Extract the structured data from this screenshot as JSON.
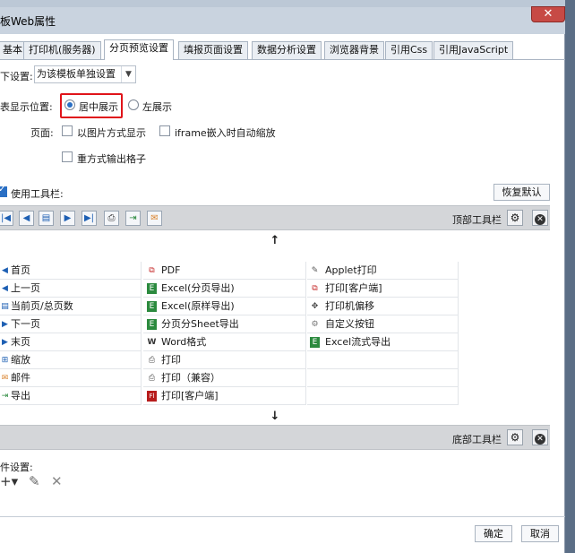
{
  "window": {
    "title": "板Web属性",
    "close_glyph": "✕"
  },
  "tabs": [
    "基本",
    "打印机(服务器)",
    "分页预览设置",
    "填报页面设置",
    "数据分析设置",
    "浏览器背景",
    "引用Css",
    "引用JavaScript"
  ],
  "form": {
    "setting_label": "下设置:",
    "setting_value": "为该模板单独设置",
    "position_label": "表显示位置:",
    "position_options": [
      {
        "label": "居中展示",
        "selected": true
      },
      {
        "label": "左展示",
        "selected": false
      }
    ],
    "page_label": "页面:",
    "page_options": [
      {
        "label": "以图片方式显示",
        "checked": false
      },
      {
        "label": "iframe嵌入时自动缩放",
        "checked": false
      },
      {
        "label": "重方式输出格子",
        "checked": false
      }
    ],
    "use_toolbar_label": "使用工具栏:",
    "use_toolbar_checked": true,
    "restore_default_label": "恢复默认"
  },
  "top_toolbar": {
    "label": "顶部工具栏",
    "icons": [
      "first-page-icon",
      "prev-page-icon",
      "page-number-icon",
      "next-page-icon",
      "last-page-icon",
      "print-icon",
      "export-icon",
      "email-icon"
    ],
    "icon_glyphs": [
      "|◀",
      "◀",
      "▤",
      "▶",
      "▶|",
      "⎙",
      "⇥",
      "✉"
    ]
  },
  "up_arrow": "↑",
  "down_arrow": "↓",
  "button_grid": {
    "col1": [
      {
        "label": "首页",
        "icon": "first-page-icon",
        "glyph": "◀"
      },
      {
        "label": "上一页",
        "icon": "prev-page-icon",
        "glyph": "◀"
      },
      {
        "label": "当前页/总页数",
        "icon": "page-number-icon",
        "glyph": "▤"
      },
      {
        "label": "下一页",
        "icon": "next-page-icon",
        "glyph": "▶"
      },
      {
        "label": "末页",
        "icon": "last-page-icon",
        "glyph": "▶"
      },
      {
        "label": "缩放",
        "icon": "zoom-icon",
        "glyph": "⊞"
      },
      {
        "label": "邮件",
        "icon": "email-icon",
        "glyph": "✉"
      },
      {
        "label": "导出",
        "icon": "export-icon",
        "glyph": "⇥"
      }
    ],
    "col2": [
      {
        "label": "PDF",
        "icon": "pdf-icon",
        "glyph": "⧉"
      },
      {
        "label": "Excel(分页导出)",
        "icon": "excel-icon",
        "glyph": "E"
      },
      {
        "label": "Excel(原样导出)",
        "icon": "excel-icon",
        "glyph": "E"
      },
      {
        "label": "分页分Sheet导出",
        "icon": "excel-icon",
        "glyph": "E"
      },
      {
        "label": "Word格式",
        "icon": "word-icon",
        "glyph": "W"
      },
      {
        "label": "打印",
        "icon": "print-icon",
        "glyph": "⎙"
      },
      {
        "label": "打印（兼容）",
        "icon": "print-icon",
        "glyph": "⎙"
      },
      {
        "label": "打印[客户端]",
        "icon": "flash-print-icon",
        "glyph": "Fl"
      }
    ],
    "col3": [
      {
        "label": "Applet打印",
        "icon": "applet-icon",
        "glyph": "✎"
      },
      {
        "label": "打印[客户端]",
        "icon": "pdf-print-icon",
        "glyph": "⧉"
      },
      {
        "label": "打印机偏移",
        "icon": "move-icon",
        "glyph": "✥"
      },
      {
        "label": "自定义按钮",
        "icon": "gear-icon",
        "glyph": "⚙"
      },
      {
        "label": "Excel流式导出",
        "icon": "excel-icon",
        "glyph": "E"
      }
    ]
  },
  "bottom_toolbar": {
    "label": "底部工具栏"
  },
  "event": {
    "label": "件设置:",
    "add_glyph": "+▾",
    "edit_glyph": "✎",
    "delete_glyph": "✕"
  },
  "footer": {
    "ok_label": "确定",
    "cancel_label": "取消"
  },
  "colors": {
    "accent": "#2a6fc4",
    "highlight_box": "#e0141a",
    "toolbar_bg": "#d4d6d9"
  }
}
